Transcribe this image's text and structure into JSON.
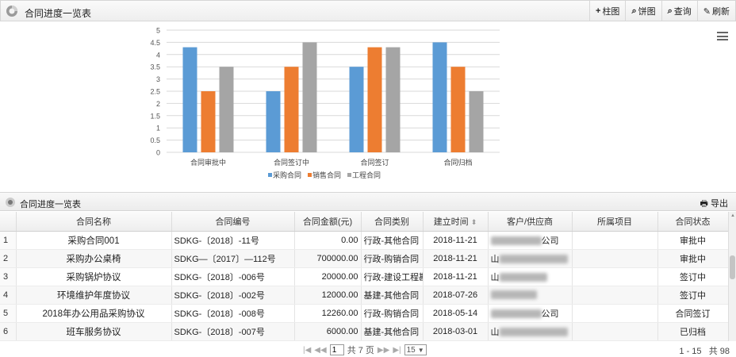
{
  "header": {
    "title": "合同进度一览表",
    "toolbar": [
      {
        "icon": "plus-icon",
        "glyph": "+",
        "label": "柱图"
      },
      {
        "icon": "search-icon",
        "glyph": "⌕",
        "label": "饼图"
      },
      {
        "icon": "search-icon",
        "glyph": "⌕",
        "label": "查询"
      },
      {
        "icon": "pencil-icon",
        "glyph": "✎",
        "label": "刷新"
      }
    ]
  },
  "chart_data": {
    "type": "bar",
    "categories": [
      "合同审批中",
      "合同签订中",
      "合同签订",
      "合同归档"
    ],
    "series": [
      {
        "name": "采购合同",
        "color": "#5b9bd5",
        "values": [
          4.3,
          2.5,
          3.5,
          4.5
        ]
      },
      {
        "name": "销售合同",
        "color": "#ed7d31",
        "values": [
          2.5,
          3.5,
          4.3,
          3.5
        ]
      },
      {
        "name": "工程合同",
        "color": "#a5a5a5",
        "values": [
          3.5,
          4.5,
          4.3,
          2.5
        ]
      }
    ],
    "ylim": [
      0,
      5
    ],
    "yticks": [
      "0",
      "0.5",
      "1",
      "1.5",
      "2",
      "2.5",
      "3",
      "3.5",
      "4",
      "4.5",
      "5"
    ],
    "grid": true,
    "legend": "bottom"
  },
  "table_panel": {
    "title": "合同进度一览表",
    "export_label": "导出",
    "columns": [
      "合同名称",
      "合同编号",
      "合同金额(元)",
      "合同类别",
      "建立时间",
      "客户/供应商",
      "所属项目",
      "合同状态"
    ],
    "rows": [
      {
        "no": "1",
        "name": "采购合同001",
        "code": "SDKG-〔2018〕-11号",
        "amount": "0.00",
        "category": "行政-其他合同",
        "date": "2018-11-21",
        "party_visible": "公司",
        "project": "",
        "status": "审批中"
      },
      {
        "no": "2",
        "name": "采购办公桌椅",
        "code": "SDKG—〔2017〕—112号",
        "amount": "700000.00",
        "category": "行政-购销合同",
        "date": "2018-11-21",
        "party_visible": "山",
        "project": "",
        "status": "审批中"
      },
      {
        "no": "3",
        "name": "采购锅炉协议",
        "code": "SDKG-〔2018〕-006号",
        "amount": "20000.00",
        "category": "行政-建设工程勘察",
        "date": "2018-11-21",
        "party_visible": "山",
        "project": "",
        "status": "签订中"
      },
      {
        "no": "4",
        "name": "环境维护年度协议",
        "code": "SDKG-〔2018〕-002号",
        "amount": "12000.00",
        "category": "基建-其他合同",
        "date": "2018-07-26",
        "party_visible": "",
        "project": "",
        "status": "签订中"
      },
      {
        "no": "5",
        "name": "2018年办公用品采购协议",
        "code": "SDKG-〔2018〕-008号",
        "amount": "12260.00",
        "category": "行政-购销合同",
        "date": "2018-05-14",
        "party_visible": "公司",
        "project": "",
        "status": "合同签订"
      },
      {
        "no": "6",
        "name": "班车服务协议",
        "code": "SDKG-〔2018〕-007号",
        "amount": "6000.00",
        "category": "基建-其他合同",
        "date": "2018-03-01",
        "party_visible": "山",
        "project": "",
        "status": "已归档"
      }
    ]
  },
  "pager": {
    "first": "|◀",
    "prev": "◀◀",
    "page": "1",
    "total_pages": "共 7 页",
    "next": "▶▶",
    "last": "▶|",
    "page_size": "15",
    "range": "1 - 15",
    "total": "共 98"
  }
}
